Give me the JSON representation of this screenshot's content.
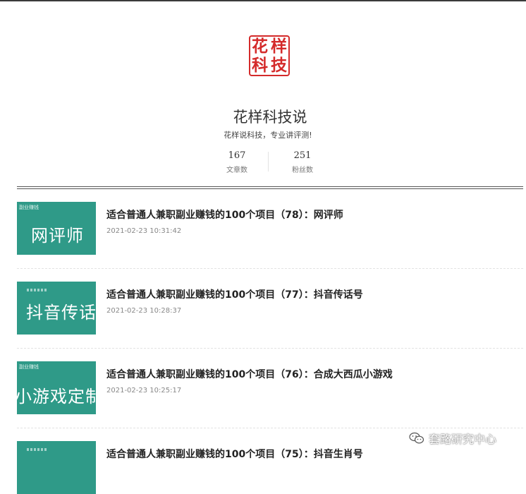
{
  "profile": {
    "logo_chars": [
      "花",
      "样",
      "科",
      "技"
    ],
    "name": "花样科技说",
    "bio": "花样说科技，专业讲评测!",
    "stats": [
      {
        "value": "167",
        "label": "文章数"
      },
      {
        "value": "251",
        "label": "粉丝数"
      }
    ]
  },
  "articles": [
    {
      "thumb_text": "网评师",
      "thumb_tag": "副业赚钱",
      "title": "适合普通人兼职副业赚钱的100个项目（78）：网评师",
      "time": "2021-02-23 10:31:42"
    },
    {
      "thumb_text": "抖音传话",
      "thumb_tag": "",
      "title": "适合普通人兼职副业赚钱的100个项目（77）：抖音传话号",
      "time": "2021-02-23 10:28:37"
    },
    {
      "thumb_text": "小游戏定制",
      "thumb_tag": "副业赚钱",
      "title": "适合普通人兼职副业赚钱的100个项目（76）：合成大西瓜小游戏",
      "time": "2021-02-23 10:25:17"
    },
    {
      "thumb_text": "",
      "thumb_tag": "",
      "title": "适合普通人兼职副业赚钱的100个项目（75）：抖音生肖号",
      "time": ""
    }
  ],
  "watermark": {
    "text": "套路研究中心",
    "icon": "wechat-icon"
  },
  "colors": {
    "logo_red": "#d42a2a",
    "thumb_green": "#2f9a88"
  }
}
